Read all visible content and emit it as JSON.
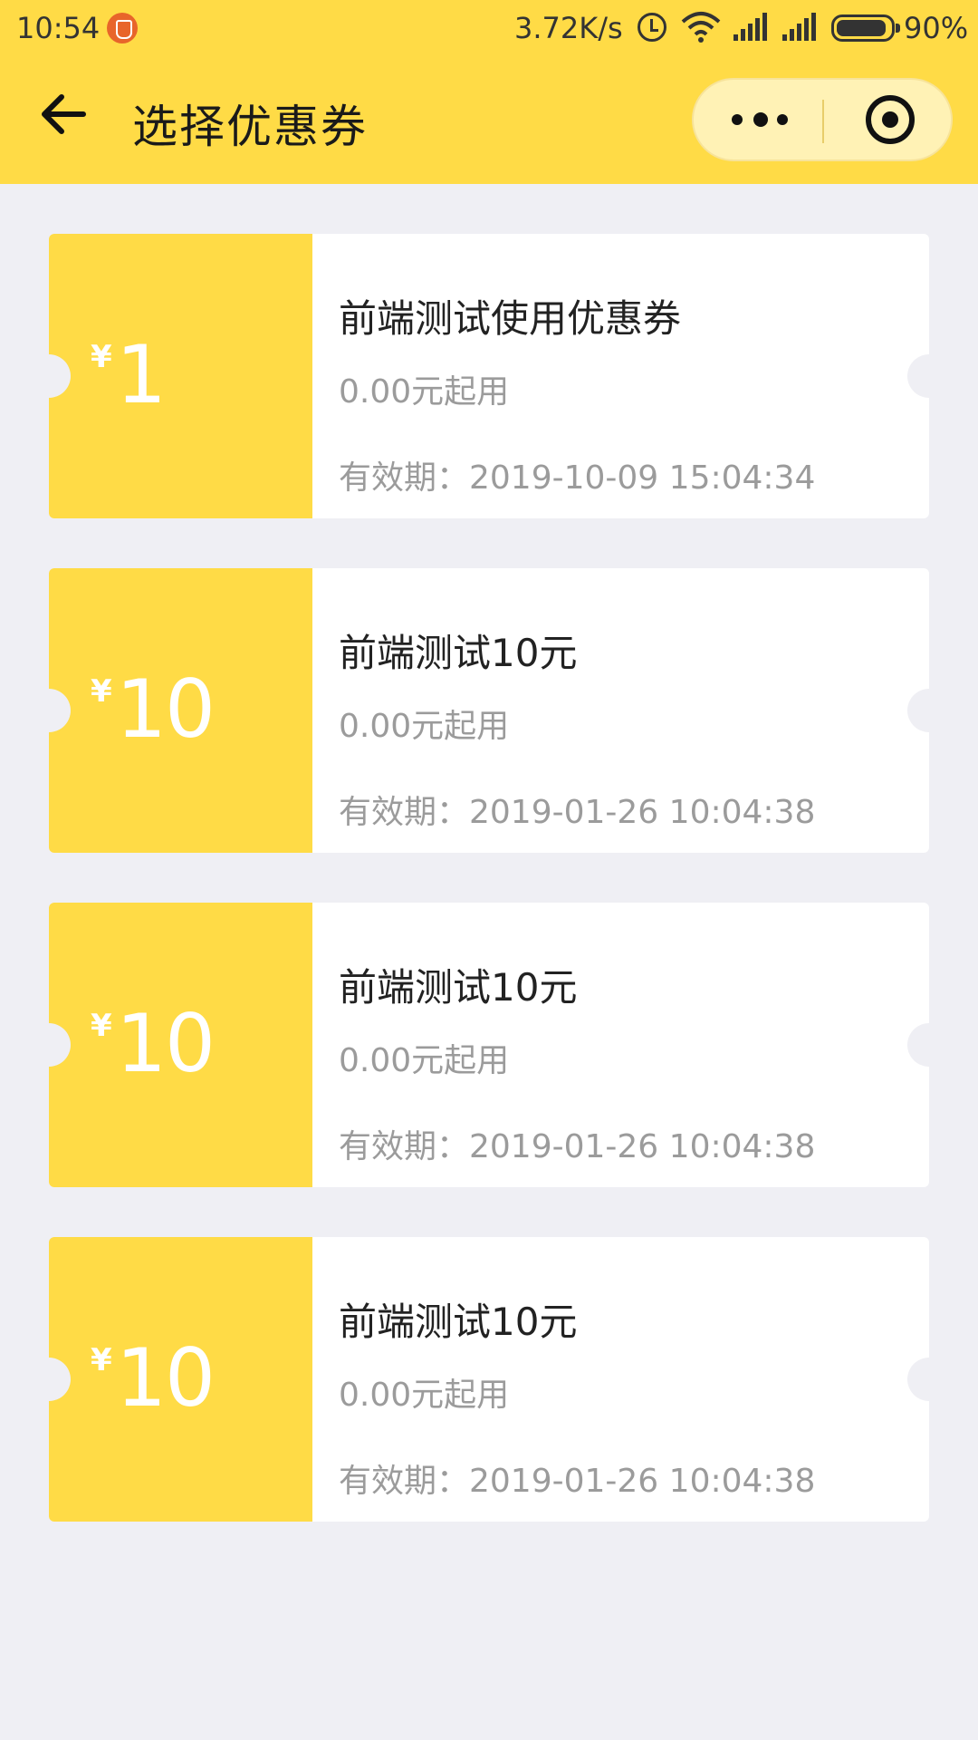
{
  "status_bar": {
    "time": "10:54",
    "speed": "3.72K/s",
    "battery": "90%"
  },
  "header": {
    "title": "选择优惠券",
    "background": "#ffdb46"
  },
  "coupons": [
    {
      "currency": "¥",
      "amount": "1",
      "name": "前端测试使用优惠券",
      "threshold": "0.00元起用",
      "validity": "有效期：2019-10-09 15:04:34"
    },
    {
      "currency": "¥",
      "amount": "10",
      "name": "前端测试10元",
      "threshold": "0.00元起用",
      "validity": "有效期：2019-01-26 10:04:38"
    },
    {
      "currency": "¥",
      "amount": "10",
      "name": "前端测试10元",
      "threshold": "0.00元起用",
      "validity": "有效期：2019-01-26 10:04:38"
    },
    {
      "currency": "¥",
      "amount": "10",
      "name": "前端测试10元",
      "threshold": "0.00元起用",
      "validity": "有效期：2019-01-26 10:04:38"
    }
  ],
  "icons": {
    "back": "arrow-left-icon",
    "more": "more-dots-icon",
    "close": "target-circle-icon"
  }
}
